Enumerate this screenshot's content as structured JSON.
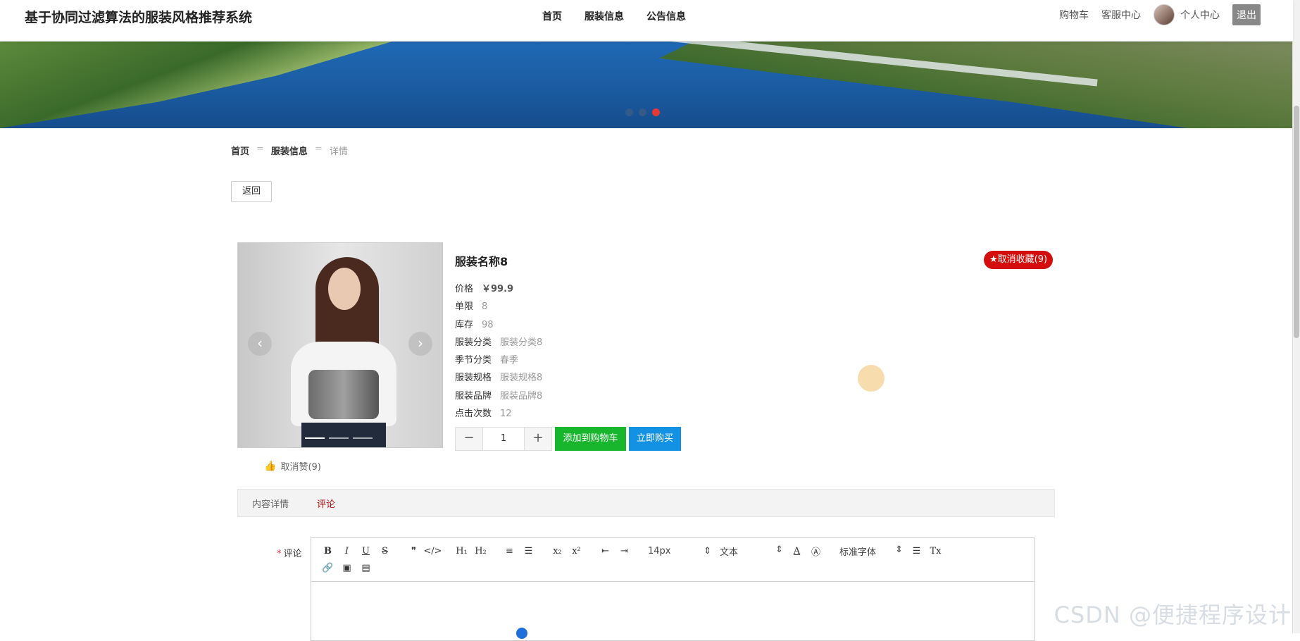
{
  "header": {
    "site_title": "基于协同过滤算法的服装风格推荐系统",
    "nav": [
      "首页",
      "服装信息",
      "公告信息"
    ],
    "cart": "购物车",
    "service": "客服中心",
    "profile": "个人中心",
    "logout": "退出"
  },
  "banner": {
    "active_slide": 3,
    "slide_count": 3
  },
  "breadcrumb": {
    "home": "首页",
    "list": "服装信息",
    "current": "详情",
    "sep": "="
  },
  "back_label": "返回",
  "product": {
    "name": "服装名称8",
    "favorite_label": "★取消收藏(9)",
    "like_label": "取消赞(9)",
    "rows": [
      {
        "label": "价格",
        "value": "￥99.9"
      },
      {
        "label": "单限",
        "value": "8"
      },
      {
        "label": "库存",
        "value": "98"
      },
      {
        "label": "服装分类",
        "value": "服装分类8"
      },
      {
        "label": "季节分类",
        "value": "春季"
      },
      {
        "label": "服装规格",
        "value": "服装规格8"
      },
      {
        "label": "服装品牌",
        "value": "服装品牌8"
      },
      {
        "label": "点击次数",
        "value": "12"
      }
    ],
    "quantity": "1",
    "add_to_cart": "添加到购物车",
    "buy_now": "立即购买"
  },
  "tabs": [
    "内容详情",
    "评论"
  ],
  "active_tab": 1,
  "comment": {
    "label": "评论",
    "required_mark": "*",
    "toolbar": {
      "font_size": "14px",
      "block": "文本",
      "font_family": "标准字体"
    }
  },
  "watermark": "CSDN @便捷程序设计"
}
